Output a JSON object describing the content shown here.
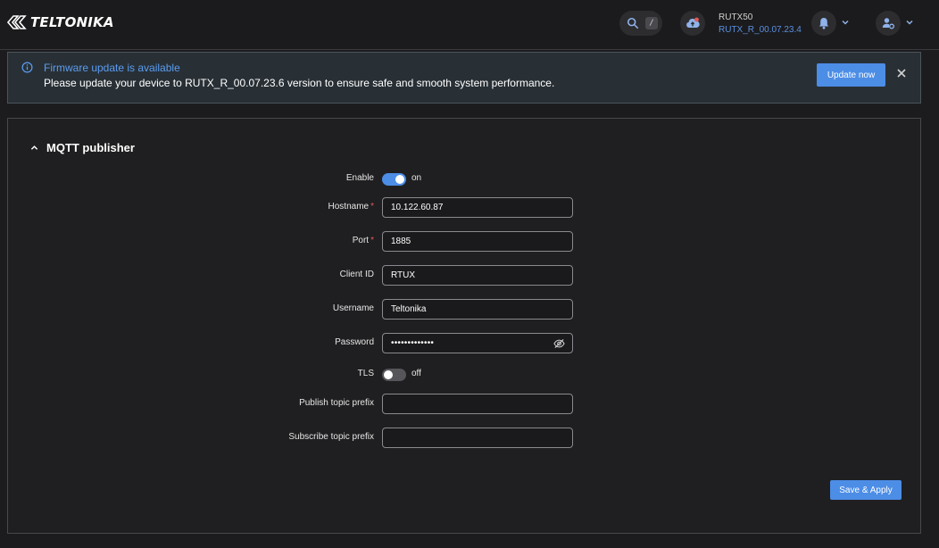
{
  "header": {
    "brand": "TELTONIKA",
    "search_shortcut": "/",
    "device_name": "RUTX50",
    "firmware_version": "RUTX_R_00.07.23.4"
  },
  "banner": {
    "title": "Firmware update is available",
    "message": "Please update your device to RUTX_R_00.07.23.6 version to ensure safe and smooth system performance.",
    "button": "Update now"
  },
  "card": {
    "title": "MQTT publisher",
    "fields": {
      "enable": {
        "label": "Enable",
        "state": "on"
      },
      "hostname": {
        "label": "Hostname",
        "value": "10.122.60.87",
        "required": "*"
      },
      "port": {
        "label": "Port",
        "value": "1885",
        "required": "*"
      },
      "client_id": {
        "label": "Client ID",
        "value": "RTUX"
      },
      "username": {
        "label": "Username",
        "value": "Teltonika"
      },
      "password": {
        "label": "Password",
        "value": "•••••••••••••"
      },
      "tls": {
        "label": "TLS",
        "state": "off"
      },
      "publish_prefix": {
        "label": "Publish topic prefix",
        "value": ""
      },
      "subscribe_prefix": {
        "label": "Subscribe topic prefix",
        "value": ""
      }
    },
    "save_button": "Save & Apply"
  },
  "colors": {
    "accent": "#4c8de6",
    "banner_bg": "#283036",
    "link": "#5b9cf0",
    "required": "#e05a5a"
  },
  "icons": [
    "teltonika-logo-icon",
    "search-icon",
    "cloud-upload-icon",
    "bell-icon",
    "user-settings-icon",
    "chevron-down-icon",
    "info-icon",
    "close-icon",
    "chevron-up-icon",
    "eye-off-icon"
  ]
}
